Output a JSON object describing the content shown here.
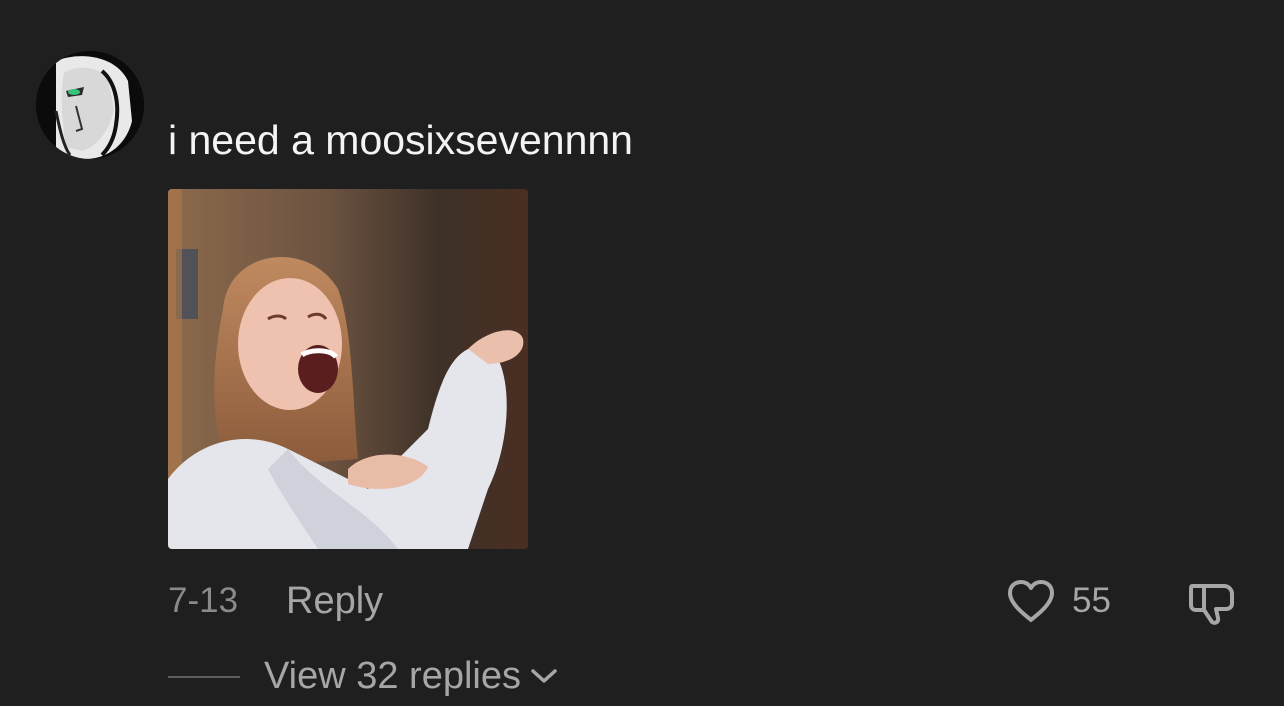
{
  "comment": {
    "avatar_icon": "user-avatar",
    "text": "i need a moosixsevennnn",
    "attachment_icon": "gif-image",
    "date": "7-13",
    "reply_label": "Reply",
    "like_icon": "heart-icon",
    "like_count": "55",
    "dislike_icon": "thumbs-down-icon",
    "view_replies_label": "View 32 replies",
    "view_replies_icon": "chevron-down-icon"
  },
  "colors": {
    "background": "#1f1f1f",
    "primary_text": "#f4f4f4",
    "secondary_text": "#a6a6a6",
    "date_text": "#8a8a8a"
  }
}
